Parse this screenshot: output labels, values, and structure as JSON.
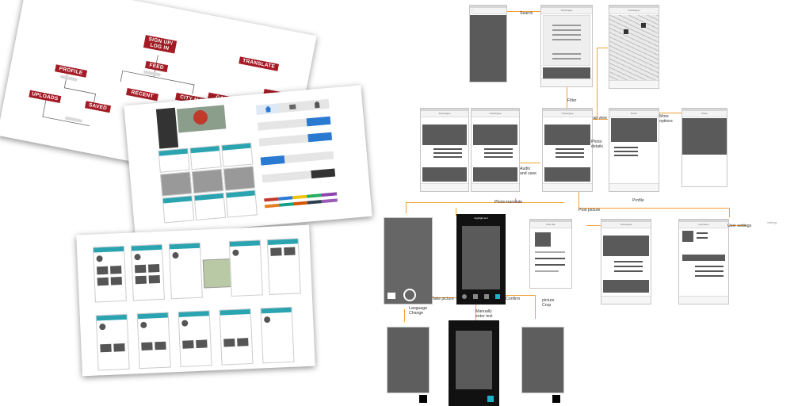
{
  "sitemap": {
    "nodes": [
      "SIGN UP/\nLOG IN",
      "FEED",
      "PROFILE",
      "UPLOADS",
      "SAVED",
      "TRANSLATE",
      "CAMERA ROLL",
      "TAKE PHOTO",
      "CITY MAP",
      "RECENT"
    ]
  },
  "flow": {
    "labels": {
      "search": "Search",
      "filter": "Filter",
      "map_view": "Map view",
      "more_options": "More\noptions",
      "photo_details": "Photo\ndetails",
      "audio_save": "Audio\nand save",
      "photo_translate": "Photo-translate",
      "post_picture": "Post picture",
      "profile": "Profile",
      "user_settings": "User settings",
      "settings": "Settings",
      "take_picture": "Take picture",
      "confirm": "Confirm",
      "language_change": "Language\nChange",
      "manually_enter": "Manually\nenter text",
      "picture_crop": "picture\nCrop"
    },
    "screen_titles": {
      "home": "Transingue",
      "photo": "Photo",
      "highlight": "Highlight text",
      "post": "Post title",
      "user": "username"
    }
  },
  "palette": {
    "accent": "#f2a033",
    "brand_red": "#a31b25",
    "teal": "#2aa4b0",
    "blue": "#2b7ad1"
  }
}
